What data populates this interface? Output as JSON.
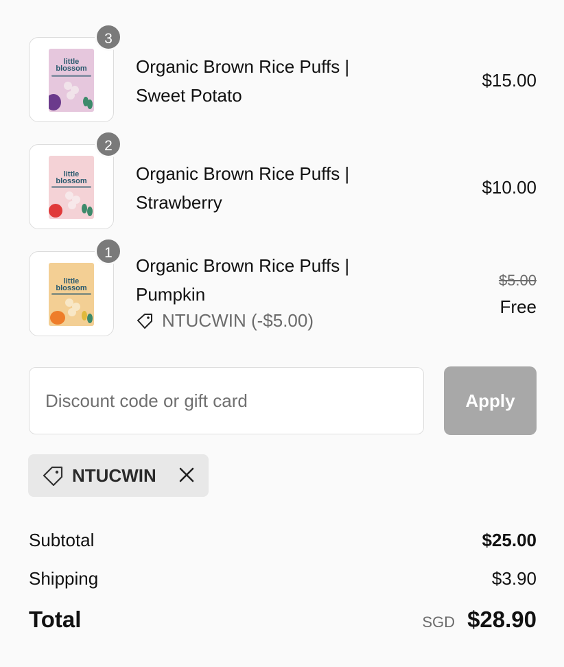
{
  "items": [
    {
      "title_line1": "Organic Brown Rice Puffs |",
      "title_line2": "Sweet Potato",
      "price": "$15.00",
      "qty": "3",
      "brand": "little blossom",
      "pack_color": "#e6c7dd",
      "fruit_color": "#6b3a8c"
    },
    {
      "title_line1": "Organic Brown Rice Puffs |",
      "title_line2": "Strawberry",
      "price": "$10.00",
      "qty": "2",
      "brand": "little blossom",
      "pack_color": "#f4d2d6",
      "fruit_color": "#e03a3a"
    },
    {
      "title_line1": "Organic Brown Rice Puffs |",
      "title_line2": "Pumpkin",
      "original_price": "$5.00",
      "price": "Free",
      "qty": "1",
      "brand": "little blossom",
      "pack_color": "#f3cf94",
      "fruit_color": "#ee7d2a",
      "discount_label": "NTUCWIN (-$5.00)"
    }
  ],
  "discount": {
    "placeholder": "Discount code or gift card",
    "apply_label": "Apply",
    "applied_code": "NTUCWIN"
  },
  "summary": {
    "subtotal_label": "Subtotal",
    "subtotal_value": "$25.00",
    "shipping_label": "Shipping",
    "shipping_value": "$3.90",
    "total_label": "Total",
    "currency": "SGD",
    "total_value": "$28.90"
  }
}
